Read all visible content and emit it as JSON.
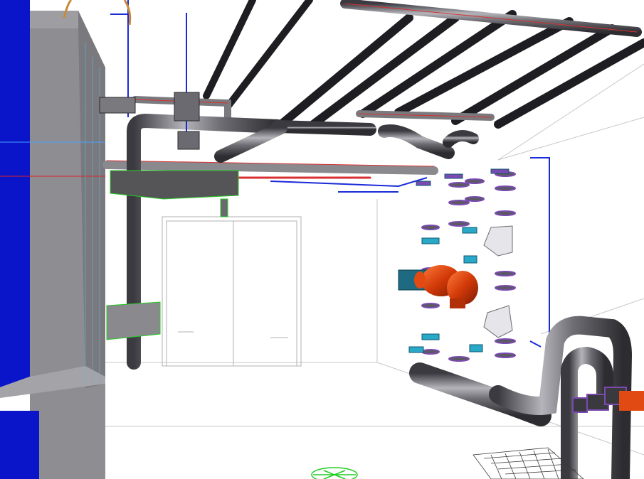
{
  "view": {
    "background": "#ffffff",
    "colors": {
      "pipe": "#6b6b70",
      "pipe_dark": "#2e2e33",
      "pipe_light": "#a8a8ae",
      "pipe_outline_red": "#d83030",
      "wall_blue": "#0a14c8",
      "wall_gray": "#8e8e92",
      "duct_green": "#22cc22",
      "flange_purple": "#7a4ab0",
      "valve_cyan": "#2aa8c8",
      "pump_orange": "#e24a14",
      "ceiling_edge": "#c8c8c8",
      "floor_grid": "#3a3a3a"
    }
  }
}
